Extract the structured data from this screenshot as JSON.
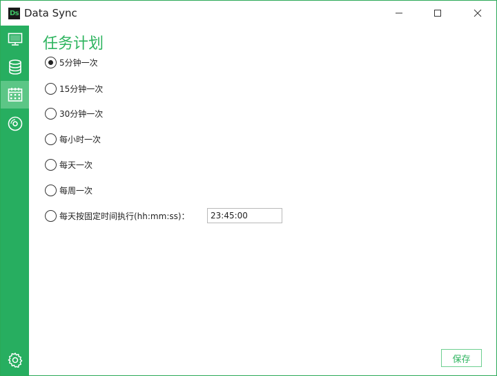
{
  "window": {
    "title": "Data Sync",
    "app_icon_text": "Ds",
    "accent_color": "#27ae60"
  },
  "sidebar": {
    "items": [
      {
        "icon": "monitor-icon",
        "active": false
      },
      {
        "icon": "database-icon",
        "active": false
      },
      {
        "icon": "calendar-icon",
        "active": true
      },
      {
        "icon": "disc-icon",
        "active": false
      }
    ],
    "bottom_icon": "gear-icon"
  },
  "main": {
    "title": "任务计划",
    "options": [
      {
        "label": "5分钟一次",
        "checked": true
      },
      {
        "label": "15分钟一次",
        "checked": false
      },
      {
        "label": "30分钟一次",
        "checked": false
      },
      {
        "label": "每小时一次",
        "checked": false
      },
      {
        "label": "每天一次",
        "checked": false
      },
      {
        "label": "每周一次",
        "checked": false
      },
      {
        "label": "每天按固定时间执行(hh:mm:ss)：",
        "checked": false
      }
    ],
    "fixed_time_value": "23:45:00",
    "save_label": "保存"
  }
}
